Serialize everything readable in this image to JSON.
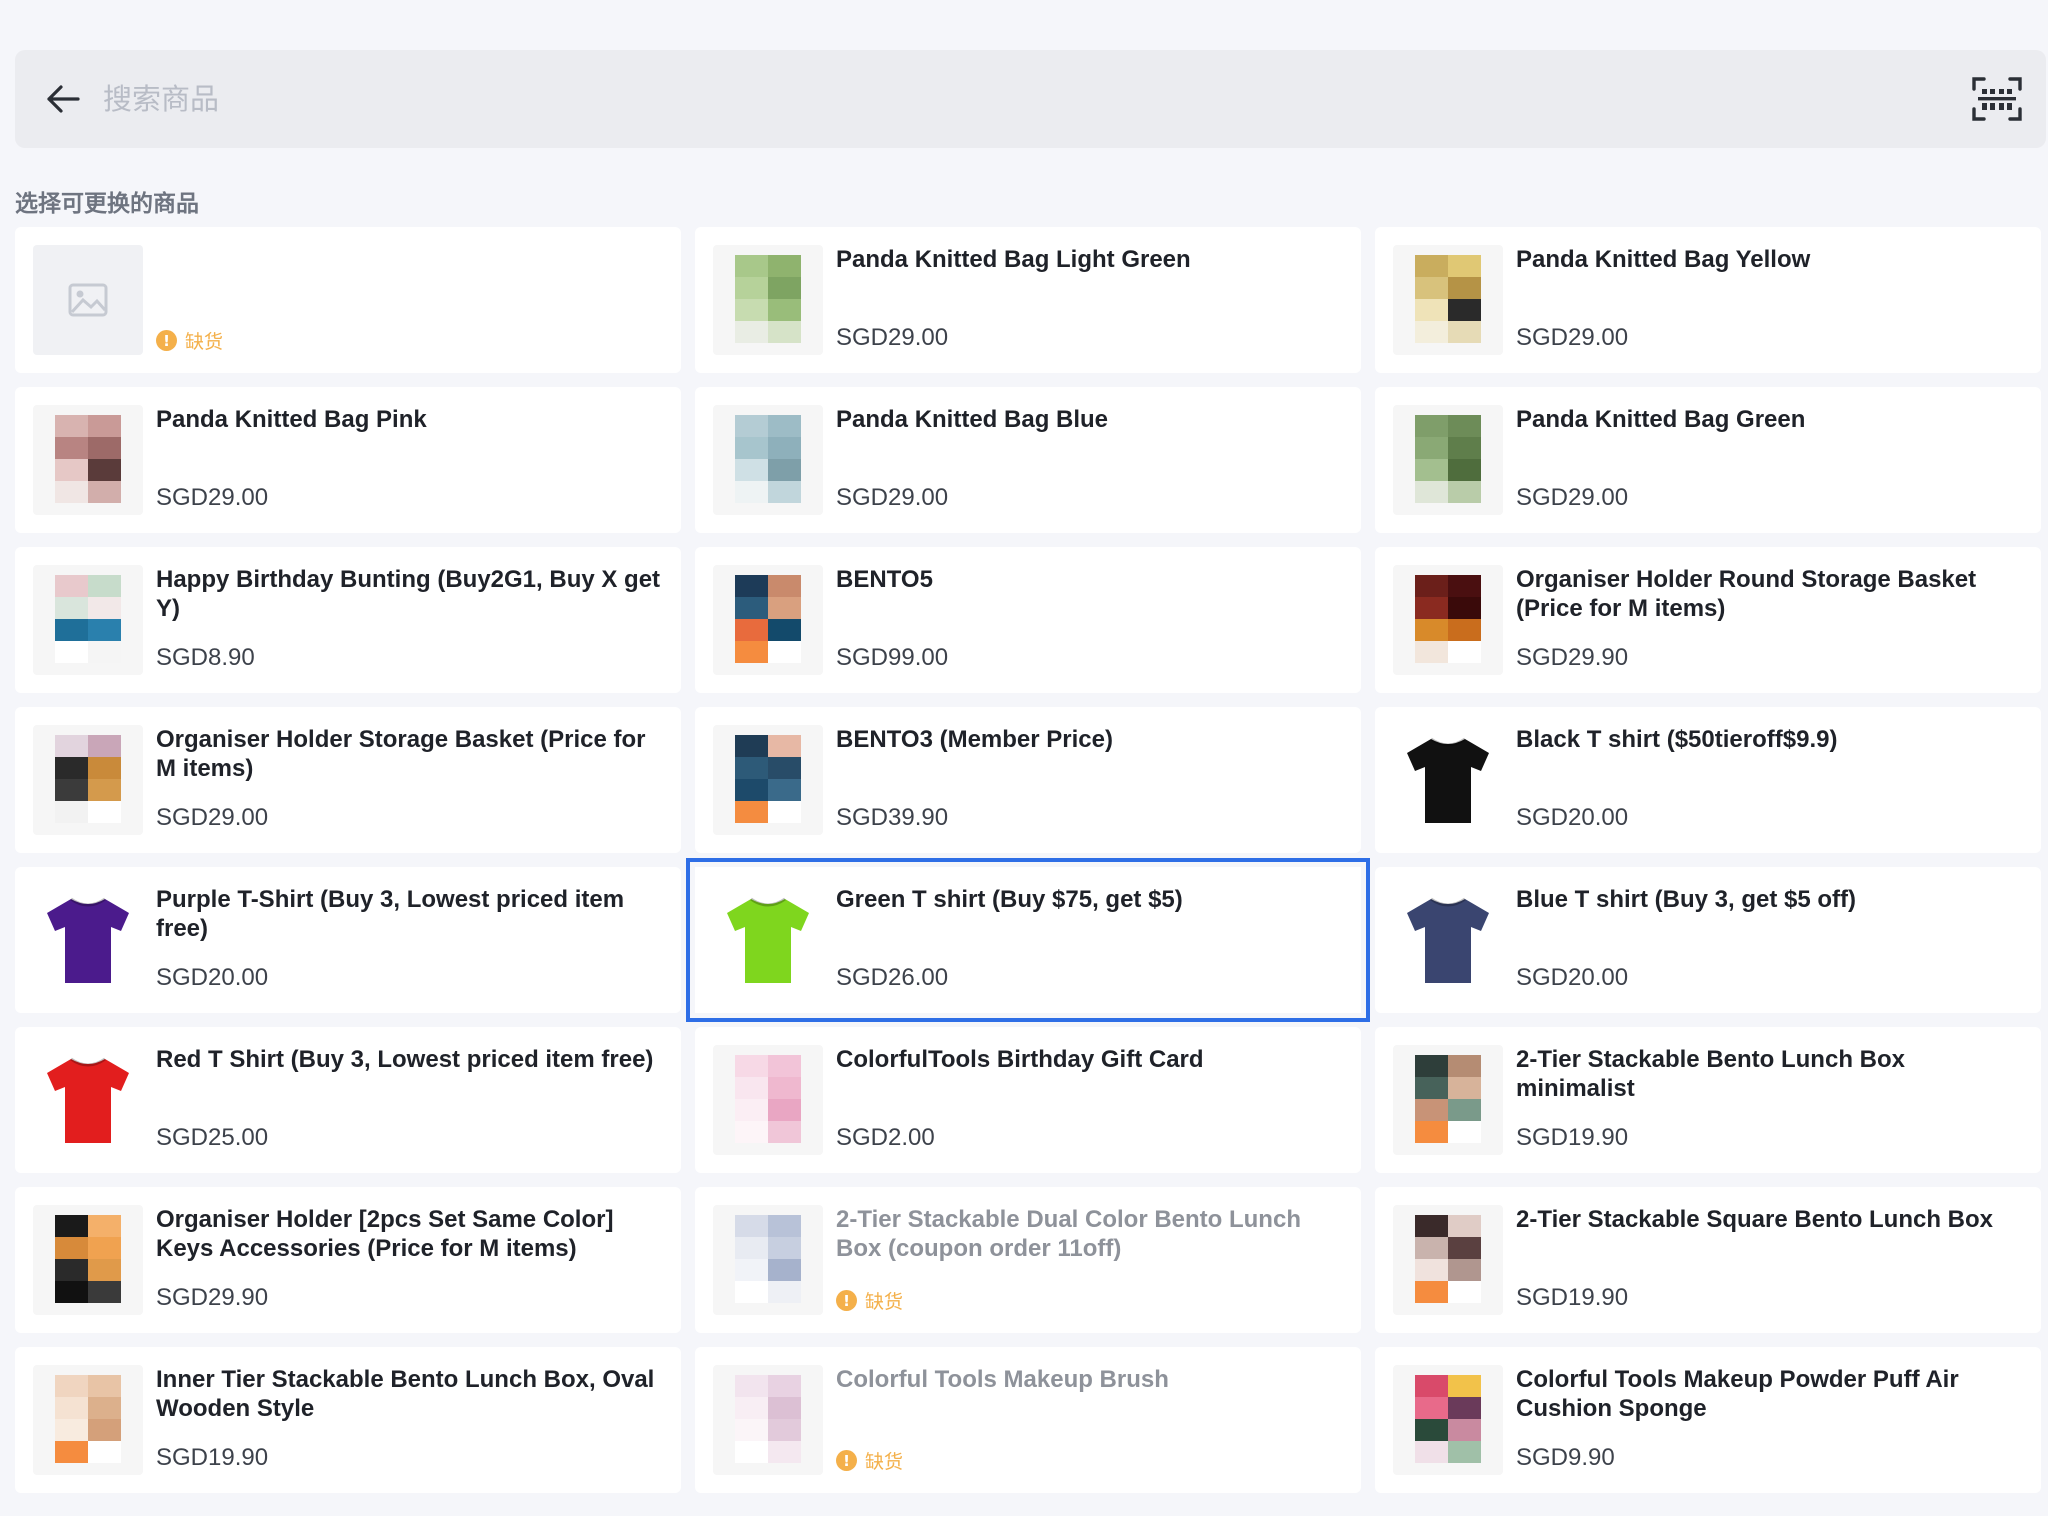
{
  "search": {
    "placeholder": "搜索商品"
  },
  "section_title": "选择可更换的商品",
  "colors": {
    "accent": "#2e6ee6",
    "out_of_stock": "#f4b04a"
  },
  "products": [
    {
      "name": "",
      "price": "",
      "status": "缺货",
      "thumb": "placeholder",
      "oos": true
    },
    {
      "name": "Panda Knitted Bag Light Green",
      "price": "SGD29.00",
      "thumb": "mosaic",
      "colors": [
        "#a8c88a",
        "#8fb36e",
        "#b6d29a",
        "#7ea462",
        "#c7dcb0",
        "#99bd7a",
        "#e9ede4",
        "#d6e3c8"
      ]
    },
    {
      "name": "Panda Knitted Bag Yellow",
      "price": "SGD29.00",
      "thumb": "mosaic",
      "colors": [
        "#c9ad5e",
        "#e0c874",
        "#d8c27c",
        "#b59346",
        "#efe3b8",
        "#2a2a2a",
        "#f3eedc",
        "#e6dbb6"
      ]
    },
    {
      "name": "Panda Knitted Bag Pink",
      "price": "SGD29.00",
      "thumb": "mosaic",
      "colors": [
        "#d8b3b0",
        "#c99a97",
        "#b88482",
        "#9d6a68",
        "#e6c8c6",
        "#5a3b3a",
        "#f0e6e4",
        "#d2aeab"
      ]
    },
    {
      "name": "Panda Knitted Bag Blue",
      "price": "SGD29.00",
      "thumb": "mosaic",
      "colors": [
        "#b4ccd4",
        "#9dbcc6",
        "#a7c5cd",
        "#8eb0bb",
        "#cfe0e5",
        "#7e9fa9",
        "#eef3f4",
        "#c1d6dc"
      ]
    },
    {
      "name": "Panda Knitted Bag Green",
      "price": "SGD29.00",
      "thumb": "mosaic",
      "colors": [
        "#7f9e6a",
        "#6d8c58",
        "#8aa975",
        "#5f7e4b",
        "#a3bf8f",
        "#4f6d3d",
        "#dfe6d8",
        "#b9cca9"
      ]
    },
    {
      "name": "Happy Birthday Bunting (Buy2G1, Buy X get Y)",
      "price": "SGD8.90",
      "thumb": "mosaic",
      "colors": [
        "#e8c9cc",
        "#c7dccb",
        "#d9e5dc",
        "#f2e8e8",
        "#1f6f99",
        "#2a80ad",
        "#ffffff",
        "#f5f5f5"
      ]
    },
    {
      "name": "BENTO5",
      "price": "SGD99.00",
      "thumb": "mosaic",
      "colors": [
        "#1d3b58",
        "#c98a6c",
        "#2c5c7c",
        "#d9a07f",
        "#e86b3d",
        "#134a6b",
        "#f58c3f",
        "#ffffff"
      ]
    },
    {
      "name": "Organiser Holder Round Storage Basket (Price for M items)",
      "price": "SGD29.90",
      "thumb": "mosaic",
      "colors": [
        "#6b1f1a",
        "#4a0f10",
        "#8a2a20",
        "#3a0a0a",
        "#d88a2a",
        "#c96d1d",
        "#f2e6dc",
        "#ffffff"
      ]
    },
    {
      "name": "Organiser Holder Storage Basket (Price for M items)",
      "price": "SGD29.00",
      "thumb": "mosaic",
      "colors": [
        "#e2d4de",
        "#c9a6b8",
        "#2a2a2a",
        "#c98a3a",
        "#3b3b3b",
        "#d49a4c",
        "#f2f2f2",
        "#ffffff"
      ]
    },
    {
      "name": "BENTO3 (Member Price)",
      "price": "SGD39.90",
      "thumb": "mosaic",
      "colors": [
        "#1f3c55",
        "#e7b8a5",
        "#2d5a78",
        "#284c68",
        "#1d4a6a",
        "#3a6a8a",
        "#f48c40",
        "#ffffff"
      ]
    },
    {
      "name": "Black T shirt ($50tieroff$9.9)",
      "price": "SGD20.00",
      "thumb": "shirt",
      "shirt_color": "#111111"
    },
    {
      "name": "Purple T-Shirt (Buy 3, Lowest priced item free)",
      "price": "SGD20.00",
      "thumb": "shirt",
      "shirt_color": "#4b1b8c"
    },
    {
      "name": "Green T shirt (Buy $75, get $5)",
      "price": "SGD26.00",
      "thumb": "shirt",
      "shirt_color": "#7fd61e",
      "selected": true
    },
    {
      "name": "Blue T shirt (Buy 3, get $5 off)",
      "price": "SGD20.00",
      "thumb": "shirt",
      "shirt_color": "#3a4570"
    },
    {
      "name": "Red T Shirt (Buy 3, Lowest priced item free)",
      "price": "SGD25.00",
      "thumb": "shirt",
      "shirt_color": "#e21e1e"
    },
    {
      "name": "ColorfulTools Birthday Gift Card",
      "price": "SGD2.00",
      "thumb": "mosaic",
      "colors": [
        "#f7d9e6",
        "#f2c4d8",
        "#f9e6ef",
        "#efb8cf",
        "#fbeef4",
        "#e9a6c3",
        "#fdf5f8",
        "#f0c6d8"
      ]
    },
    {
      "name": "2-Tier Stackable Bento Lunch Box minimalist",
      "price": "SGD19.90",
      "thumb": "mosaic",
      "colors": [
        "#2e3e3a",
        "#b58c73",
        "#47625a",
        "#d7b39a",
        "#c89377",
        "#7a9a8a",
        "#f58c3f",
        "#ffffff"
      ]
    },
    {
      "name": "Organiser Holder [2pcs Set Same Color] Keys Accessories (Price for M items)",
      "price": "SGD29.90",
      "thumb": "mosaic",
      "colors": [
        "#1a1a1a",
        "#f4b06a",
        "#d78a3a",
        "#f0a250",
        "#2a2a2a",
        "#e09a4a",
        "#111111",
        "#3a3a3a"
      ]
    },
    {
      "name": "2-Tier Stackable Dual Color Bento Lunch Box (coupon order 11off)",
      "price": "",
      "status": "缺货",
      "oos": true,
      "thumb": "mosaic",
      "colors": [
        "#d6dbe8",
        "#b8c2d8",
        "#e8ebf2",
        "#c7cfe0",
        "#f1f3f8",
        "#a6b2cc",
        "#ffffff",
        "#eef0f5"
      ]
    },
    {
      "name": "2-Tier Stackable Square Bento Lunch Box",
      "price": "SGD19.90",
      "thumb": "mosaic",
      "colors": [
        "#3a2a2a",
        "#e0ccc6",
        "#c9b3ad",
        "#5a4040",
        "#f0e2dd",
        "#b0968f",
        "#f58c3f",
        "#ffffff"
      ]
    },
    {
      "name": "Inner Tier Stackable Bento Lunch Box, Oval Wooden Style",
      "price": "SGD19.90",
      "thumb": "mosaic",
      "colors": [
        "#f0d5c0",
        "#e8c4a6",
        "#f5e2d2",
        "#dcb08c",
        "#f8ebdf",
        "#d4a07a",
        "#f58c3f",
        "#ffffff"
      ]
    },
    {
      "name": "Colorful Tools Makeup Brush",
      "price": "",
      "status": "缺货",
      "oos": true,
      "thumb": "mosaic",
      "colors": [
        "#f2e4ee",
        "#e8d2e2",
        "#f8eef4",
        "#dcc0d4",
        "#fbf5f8",
        "#e2cadb",
        "#ffffff",
        "#f4e8f0"
      ]
    },
    {
      "name": "Colorful Tools Makeup Powder Puff Air Cushion Sponge",
      "price": "SGD9.90",
      "thumb": "mosaic",
      "colors": [
        "#d94a6a",
        "#f2c24a",
        "#e86a8a",
        "#6a3a5a",
        "#2a4a3a",
        "#c98aa0",
        "#f0e0e8",
        "#a0c0a8"
      ]
    }
  ]
}
